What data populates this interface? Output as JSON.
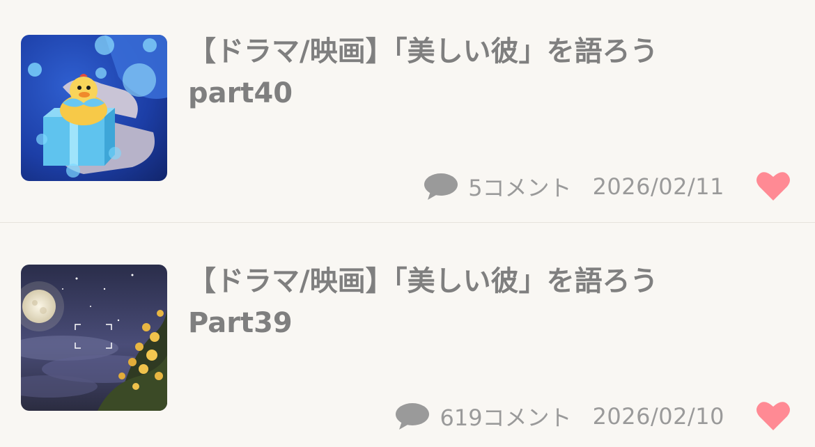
{
  "items": [
    {
      "title_line1": "【ドラマ/映画】「美しい彼」を語ろう",
      "title_line2": "part40",
      "comments": "5コメント",
      "date": "2026/02/11",
      "thumbnail": "rubber-duck-gift-illustration",
      "liked": true
    },
    {
      "title_line1": "【ドラマ/映画】「美しい彼」を語ろう",
      "title_line2": "Part39",
      "comments": "619コメント",
      "date": "2026/02/10",
      "thumbnail": "full-moon-night-flowers-photo",
      "liked": true
    }
  ],
  "icons": {
    "comment": "speech-bubble-icon",
    "like": "heart-icon"
  },
  "colors": {
    "background": "#f9f7f3",
    "title": "#7f7f7f",
    "meta": "#9a9a9a",
    "heart": "#ff8a94",
    "divider": "#e6e2dc"
  }
}
